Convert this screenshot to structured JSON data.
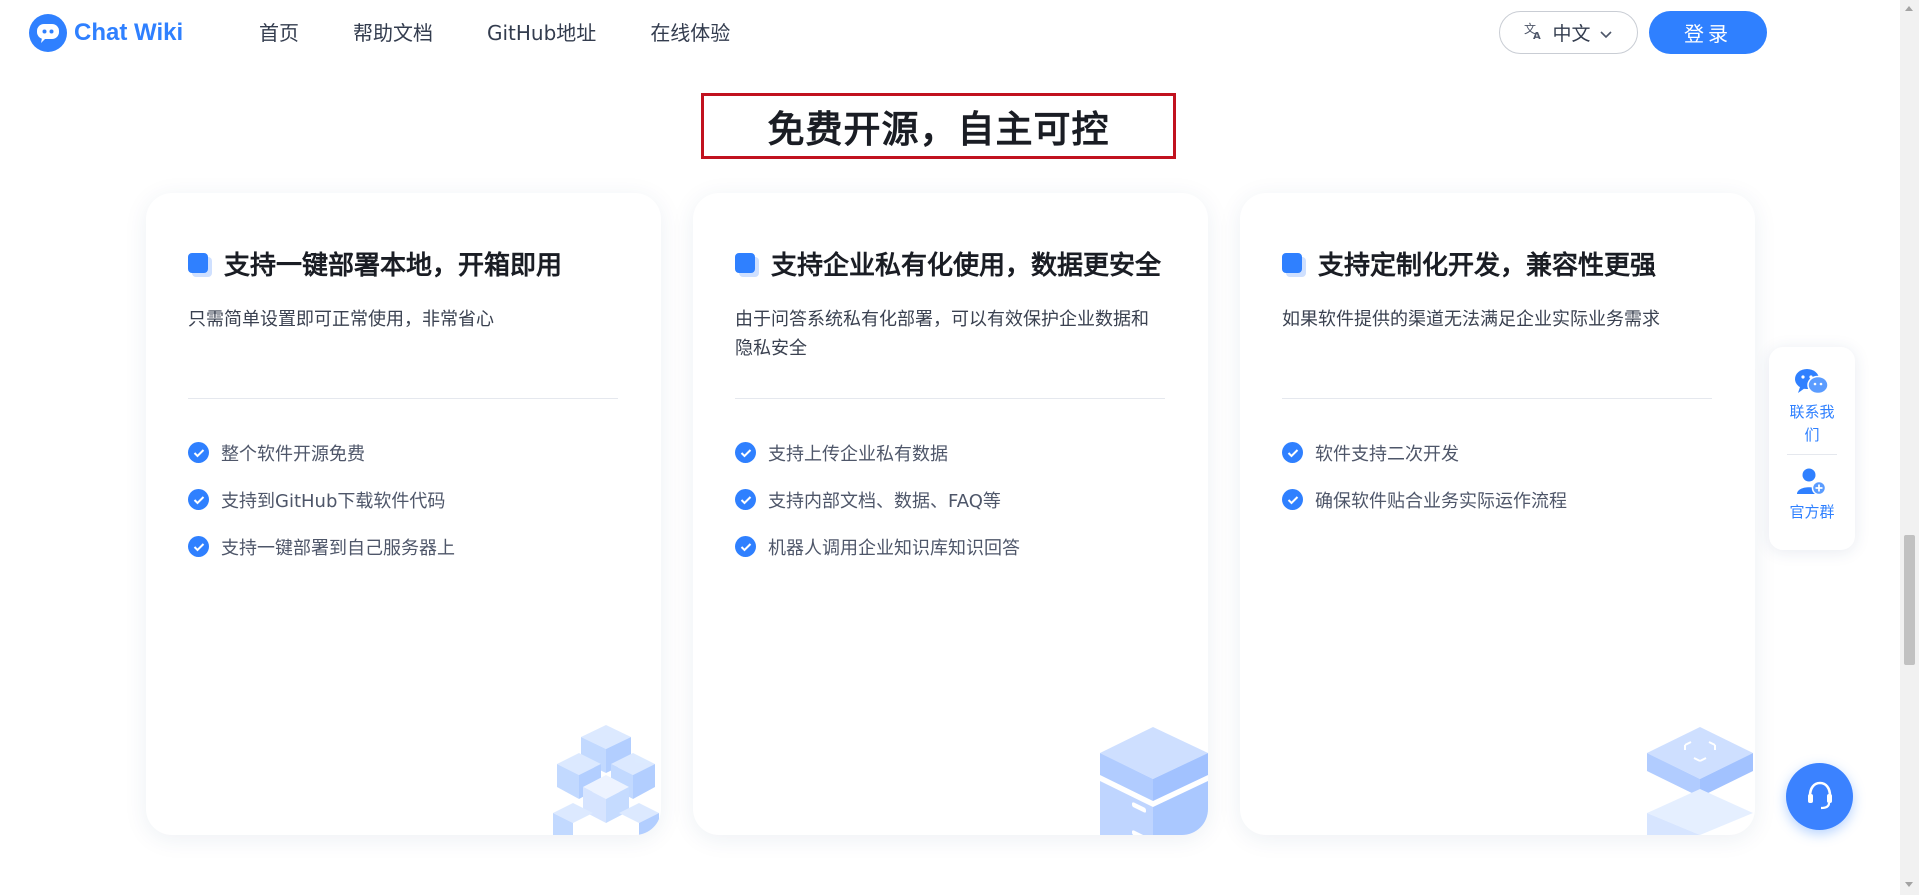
{
  "header": {
    "logo_text": "Chat Wiki",
    "nav": [
      "首页",
      "帮助文档",
      "GitHub地址",
      "在线体验"
    ],
    "language": "中文",
    "login_label": "登录"
  },
  "section": {
    "title": "免费开源，自主可控"
  },
  "cards": [
    {
      "title": "支持一键部署本地，开箱即用",
      "desc": "只需简单设置即可正常使用，非常省心",
      "features": [
        "整个软件开源免费",
        "支持到GitHub下载软件代码",
        "支持一键部署到自己服务器上"
      ]
    },
    {
      "title": "支持企业私有化使用，数据更安全",
      "desc": "由于问答系统私有化部署，可以有效保护企业数据和隐私安全",
      "features": [
        "支持上传企业私有数据",
        "支持内部文档、数据、FAQ等",
        "机器人调用企业知识库知识回答"
      ]
    },
    {
      "title": "支持定制化开发，兼容性更强",
      "desc": "如果软件提供的渠道无法满足企业实际业务需求",
      "features": [
        "软件支持二次开发",
        "确保软件贴合业务实际运作流程"
      ]
    }
  ],
  "float_panel": {
    "contact_label": "联系我们",
    "group_label": "官方群"
  },
  "colors": {
    "accent": "#2f80ff",
    "highlight_border": "#c1121f"
  }
}
